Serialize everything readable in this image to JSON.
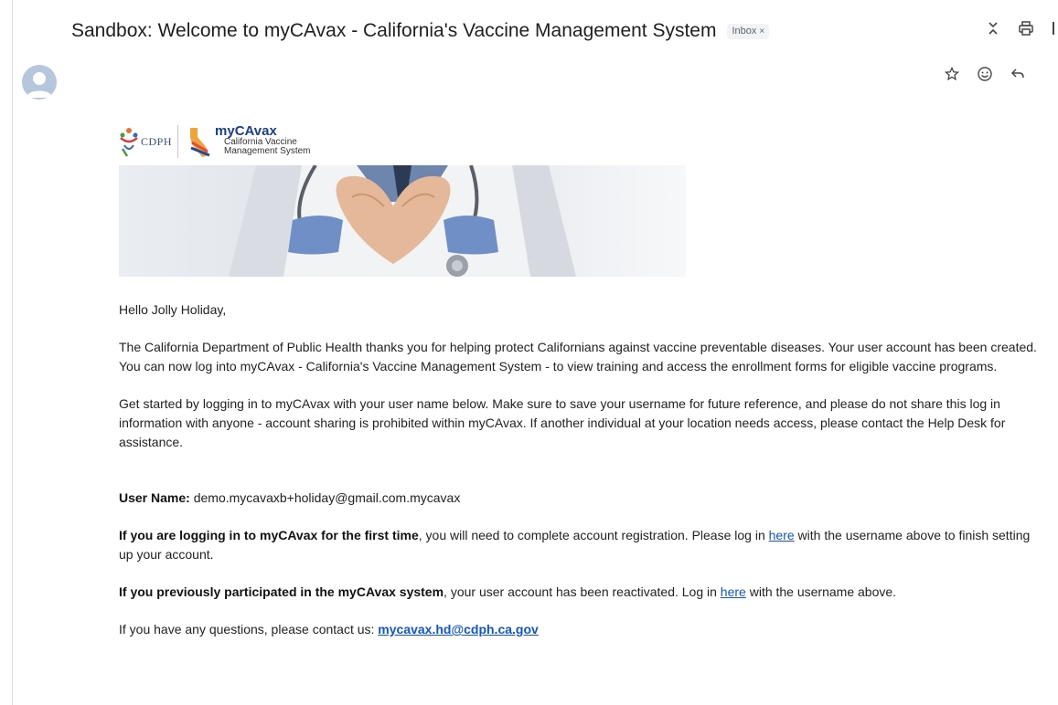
{
  "email": {
    "subject": "Sandbox: Welcome to myCAvax - California's Vaccine Management System",
    "label": "Inbox",
    "label_close": "×"
  },
  "logos": {
    "cdph_text": "CDPH",
    "brand_my": "my",
    "brand_cavax": "CAvax",
    "tagline_1": "California Vaccine",
    "tagline_2": "Management System"
  },
  "body": {
    "greeting": "Hello Jolly Holiday,",
    "para1": "The California Department of Public Health thanks you for helping protect Californians against vaccine preventable diseases. Your user account has been created. You can now log into myCAvax - California's Vaccine Management System - to view training and access the enrollment forms for eligible vaccine programs.",
    "para2": "Get started by logging in to myCAvax with your user name below. Make sure to save your username for future reference, and please do not share this log in information with anyone - account sharing is prohibited within myCAvax. If another individual at your location needs access, please contact the Help Desk for assistance.",
    "username_label": "User Name:",
    "username_value": " demo.mycavaxb+holiday@gmail.com.mycavax",
    "first_time_bold": "If you are logging in to myCAvax for the first time",
    "first_time_text": ", you will need to complete account registration. Please log in ",
    "first_time_link": "here",
    "first_time_end": " with the username above to finish setting up your account.",
    "previous_bold": "If you previously participated in the myCAvax system",
    "previous_text": ", your user account has been reactivated. Log in ",
    "previous_link": "here",
    "previous_end": " with the username above.",
    "questions_text": "If you have any questions, please contact us: ",
    "questions_email": "mycavax.hd@cdph.ca.gov"
  },
  "icons": {
    "expand": "expand-icon",
    "print": "print-icon",
    "star": "star-icon",
    "emoji": "emoji-icon",
    "reply": "reply-icon",
    "avatar": "avatar-icon"
  }
}
